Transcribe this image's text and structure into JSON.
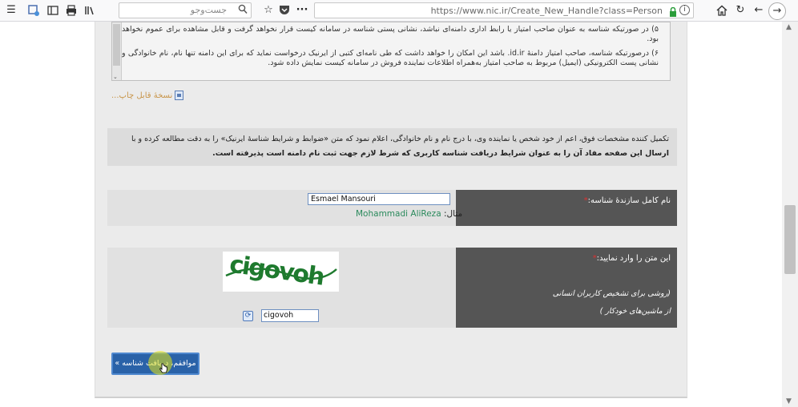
{
  "browser": {
    "search_placeholder": "جست‌وجو",
    "url": "https://www.nic.ir/Create_New_Handle?class=Person",
    "icons": [
      "menu-icon",
      "extension-icon",
      "sidebar-icon",
      "print-icon",
      "library-icon",
      "search-icon",
      "bookmark-star-icon",
      "pocket-icon",
      "more-icon",
      "reader-icon",
      "lock-icon",
      "info-icon",
      "home-icon",
      "reload-icon",
      "back-icon",
      "forward-icon"
    ]
  },
  "terms": {
    "item5": "۵) در صورتیکه شناسه به عنوان صاحب امتیاز یا رابط اداری دامنه‌ای نباشد، نشانی پستی شناسه در سامانه کیست قرار نخواهد گرفت و قابل مشاهده برای عموم نخواهد بود.",
    "item6": "۶) درصورتیکه شناسه، صاحب امتیاز دامنهٔ ‪.id.ir‬ باشد این امکان را خواهد داشت که طی نامه‌ای کتبی از ایرنیک درخواست نماید که برای این دامنه تنها نام، نام خانوادگی و نشانی پست الکترونیکی (ایمیل) مربوط به صاحب امتیاز به‌همراه اطلاعات نماینده فروش در سامانه کیست نمایش داده شود."
  },
  "print_link": "نسخهٔ قابل چاپ...",
  "notice": {
    "line1": "تکمیل کننده مشخصات فوق، اعم از خود شخص یا نماینده وی، با درج نام و نام خانوادگی، اعلام نمود که متن «ضوابط و شرایط شناسهٔ ایرنیک» را به دقت مطالعه کرده و با",
    "line2": "ارسال این صفحه مفاد آن را به عنوان شرایط دریافت شناسه کاربری که شرط لازم جهت ثبت نام دامنه است پذیرفته است."
  },
  "form": {
    "name_label": "نام کامل سازندهٔ شناسه:",
    "name_value": "Esmael Mansouri",
    "example_prefix": "مثال:",
    "example_value": "Mohammadi AliReza",
    "captcha_label": "این متن را وارد نمایید:",
    "captcha_hint1": "(روشی برای تشخیص کاربران انسانی",
    "captcha_hint2": "از ماشین‌های خودکار )",
    "captcha_image_text": "cigovoh",
    "captcha_value": "cigovoh",
    "required_mark": "*"
  },
  "submit_label": "موافقم، دریافت شناسه »",
  "colors": {
    "submit_bg": "#2a62a8",
    "label_bg": "#555555",
    "required": "#e03030",
    "example_value": "#2a8a5c",
    "print_link": "#c8954a"
  }
}
